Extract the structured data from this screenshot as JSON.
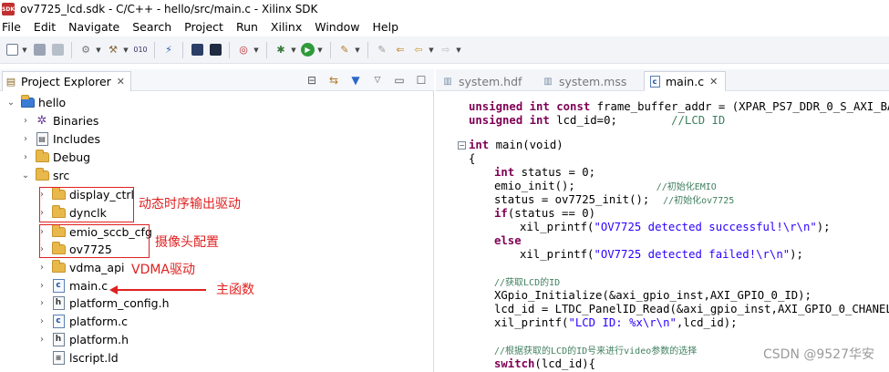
{
  "window": {
    "title": "ov7725_lcd.sdk - C/C++ - hello/src/main.c - Xilinx SDK",
    "app_icon_text": "SDK"
  },
  "menu": [
    "File",
    "Edit",
    "Navigate",
    "Search",
    "Project",
    "Run",
    "Xilinx",
    "Window",
    "Help"
  ],
  "explorer": {
    "tab_label": "Project Explorer",
    "close_glyph": "✕",
    "tree": [
      {
        "label": "hello",
        "expanded": true,
        "icon": "project-folder-icon"
      },
      {
        "label": "Binaries",
        "icon": "binaries-icon"
      },
      {
        "label": "Includes",
        "icon": "includes-icon"
      },
      {
        "label": "Debug",
        "icon": "folder-icon"
      },
      {
        "label": "src",
        "expanded": true,
        "icon": "folder-icon"
      },
      {
        "label": "display_ctrl",
        "icon": "folder-icon"
      },
      {
        "label": "dynclk",
        "icon": "folder-icon"
      },
      {
        "label": "emio_sccb_cfg",
        "icon": "folder-icon"
      },
      {
        "label": "ov7725",
        "icon": "folder-icon"
      },
      {
        "label": "vdma_api",
        "icon": "folder-icon"
      },
      {
        "label": "main.c",
        "icon": "c-file-icon"
      },
      {
        "label": "platform_config.h",
        "icon": "h-file-icon"
      },
      {
        "label": "platform.c",
        "icon": "c-file-icon"
      },
      {
        "label": "platform.h",
        "icon": "h-file-icon"
      },
      {
        "label": "lscript.ld",
        "icon": "ld-file-icon"
      }
    ],
    "annotations": {
      "display": "动态时序输出驱动",
      "camera": "摄像头配置",
      "vdma": "VDMA驱动",
      "main": "主函数"
    },
    "annotation_color": "#e02020"
  },
  "editor": {
    "tabs": [
      {
        "label": "system.hdf",
        "active": false
      },
      {
        "label": "system.mss",
        "active": false
      },
      {
        "label": "main.c",
        "active": true
      }
    ],
    "code": {
      "l1_kw": "unsigned int const",
      "l1_rest": " frame_buffer_addr = (XPAR_PS7_DDR_0_S_AXI_BASEA",
      "l2_kw": "unsigned int",
      "l2_rest": " lcd_id=0;        ",
      "l2_cm": "//LCD ID",
      "l3_kw": "int",
      "l3_rest": " main(void)",
      "l4": "{",
      "l5_kw": "int",
      "l5_rest": " status = 0;",
      "l6_code": "emio_init();            ",
      "l6_cm": "//初始化EMIO",
      "l7_code": "status = ov7725_init();  ",
      "l7_cm": "//初始化ov7725",
      "l8_kw": "if",
      "l8_rest": "(status == 0)",
      "l9_fn": "xil_printf(",
      "l9_str": "\"OV7725 detected successful!\\r\\n\"",
      "l9_end": ");",
      "l10_kw": "else",
      "l11_fn": "xil_printf(",
      "l11_str": "\"OV7725 detected failed!\\r\\n\"",
      "l11_end": ");",
      "l12_cm": "//获取LCD的ID",
      "l13": "XGpio_Initialize(&axi_gpio_inst,AXI_GPIO_0_ID);",
      "l14": "lcd_id = LTDC_PanelID_Read(&axi_gpio_inst,AXI_GPIO_0_CHANEL);",
      "l15_fn": "xil_printf(",
      "l15_str": "\"LCD ID: %x\\r\\n\"",
      "l15_end": ",lcd_id);",
      "l16_cm": "//根据获取的LCD的ID号来进行video参数的选择",
      "l17_kw": "switch",
      "l17_rest": "(lcd_id){"
    },
    "colors": {
      "keyword": "#7f0055",
      "comment": "#3f7f5f",
      "string": "#2a00ff"
    }
  },
  "watermark": "CSDN @9527华安"
}
